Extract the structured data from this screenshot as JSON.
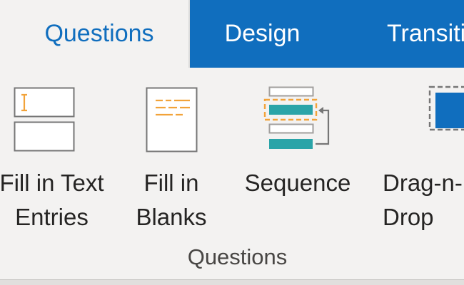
{
  "tabs": [
    {
      "label": "Questions",
      "active": true
    },
    {
      "label": "Design",
      "active": false
    },
    {
      "label": "Transitions",
      "active": false
    }
  ],
  "ribbon": {
    "commands": [
      {
        "label": "Fill in Text\nEntries",
        "icon": "text-entry-icon"
      },
      {
        "label": "Fill in\nBlanks",
        "icon": "fill-blanks-icon"
      },
      {
        "label": "Sequence",
        "icon": "sequence-icon"
      },
      {
        "label": "Drag-n-Drop",
        "icon": "drag-drop-icon"
      }
    ],
    "group_label": "Questions"
  },
  "colors": {
    "tab_bar": "#106ebe",
    "active_tab_text": "#106ebe",
    "accent_orange": "#f2a33a",
    "accent_teal": "#2aa4a8",
    "icon_outline": "#767676"
  }
}
